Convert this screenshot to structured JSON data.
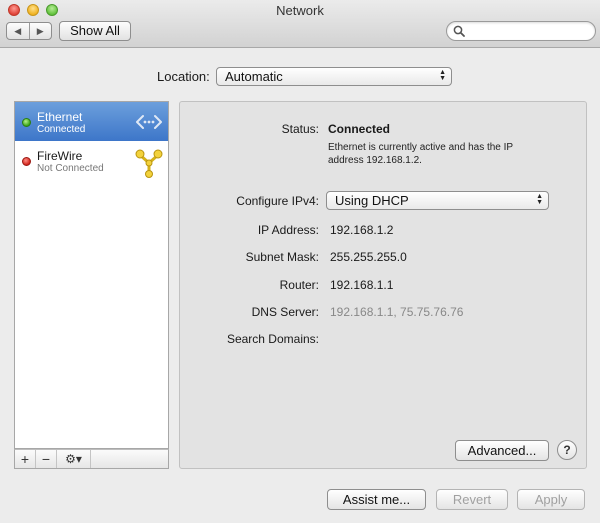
{
  "window": {
    "title": "Network",
    "nav_back": "◀",
    "nav_forward": "▶",
    "show_all": "Show All",
    "search_placeholder": ""
  },
  "location": {
    "label": "Location:",
    "value": "Automatic"
  },
  "services": [
    {
      "name": "Ethernet",
      "status": "Connected",
      "indicator": "green",
      "icon": "ethernet-icon",
      "selected": true
    },
    {
      "name": "FireWire",
      "status": "Not Connected",
      "indicator": "red",
      "icon": "firewire-icon",
      "selected": false
    }
  ],
  "sidebar_controls": {
    "add": "+",
    "remove": "−",
    "action": "⚙▾"
  },
  "details": {
    "status_label": "Status:",
    "status_value": "Connected",
    "status_description": "Ethernet is currently active and has the IP address 192.168.1.2.",
    "configure_label": "Configure IPv4:",
    "configure_value": "Using DHCP",
    "ip_label": "IP Address:",
    "ip_value": "192.168.1.2",
    "subnet_label": "Subnet Mask:",
    "subnet_value": "255.255.255.0",
    "router_label": "Router:",
    "router_value": "192.168.1.1",
    "dns_label": "DNS Server:",
    "dns_value": "192.168.1.1, 75.75.76.76",
    "search_domains_label": "Search Domains:",
    "advanced_button": "Advanced...",
    "help_button": "?"
  },
  "footer": {
    "assist": "Assist me...",
    "revert": "Revert",
    "apply": "Apply"
  },
  "colors": {
    "selection": "#3d76c9",
    "status_green": "#3aa417",
    "status_red": "#d0231a"
  }
}
